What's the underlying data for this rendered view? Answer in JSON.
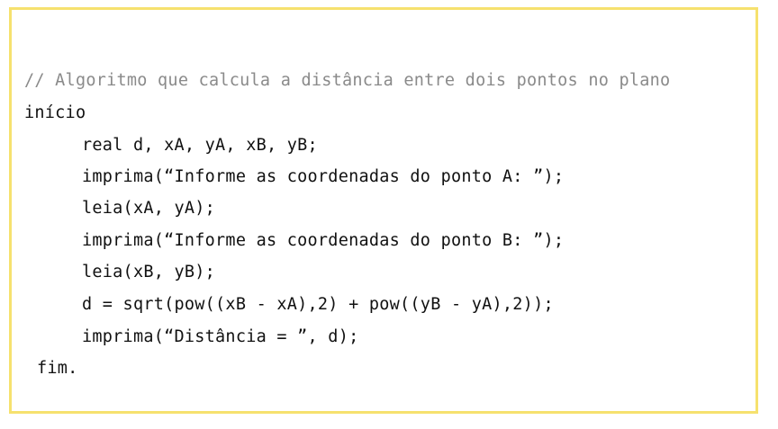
{
  "code": {
    "comment": "// Algoritmo que calcula a distância entre dois pontos no plano",
    "lines": [
      "início",
      "real d, xA, yA, xB, yB;",
      "imprima(“Informe as coordenadas do ponto A: ”);",
      "leia(xA, yA);",
      "imprima(“Informe as coordenadas do ponto B: ”);",
      "leia(xB, yB);",
      "d = sqrt(pow((xB - xA),2) + pow((yB - yA),2));",
      "imprima(“Distância = ”, d);",
      "fim."
    ]
  },
  "colors": {
    "border": "#f6e16e",
    "comment": "#8a8a8a",
    "text": "#111111",
    "background": "#ffffff"
  }
}
